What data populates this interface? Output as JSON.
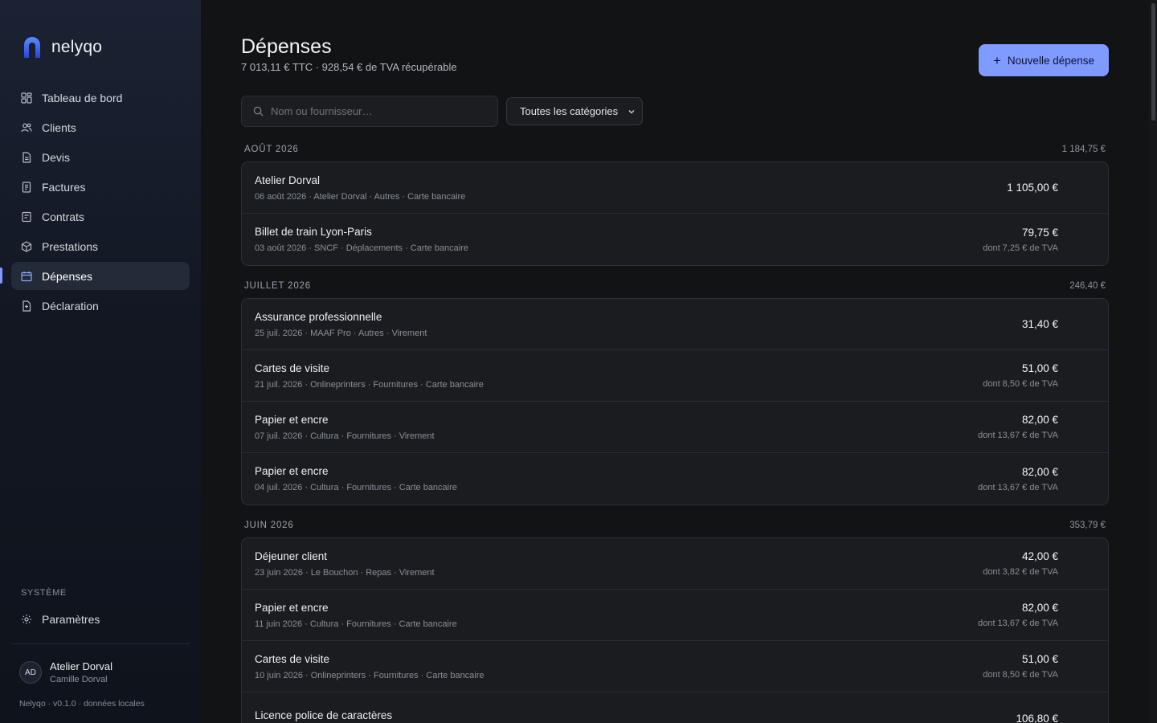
{
  "brand": {
    "name": "nelyqo"
  },
  "nav": [
    {
      "label": "Tableau de bord",
      "icon": "dashboard-icon"
    },
    {
      "label": "Clients",
      "icon": "users-icon"
    },
    {
      "label": "Devis",
      "icon": "document-icon"
    },
    {
      "label": "Factures",
      "icon": "invoice-icon"
    },
    {
      "label": "Contrats",
      "icon": "contract-icon"
    },
    {
      "label": "Prestations",
      "icon": "box-icon"
    },
    {
      "label": "Dépenses",
      "icon": "wallet-icon",
      "active": true
    },
    {
      "label": "Déclaration",
      "icon": "declaration-icon"
    }
  ],
  "system": {
    "label": "SYSTÈME",
    "settings_label": "Paramètres"
  },
  "user": {
    "initials": "AD",
    "name": "Atelier Dorval",
    "sub": "Camille Dorval"
  },
  "version": "Nelyqo · v0.1.0 · données locales",
  "header": {
    "title": "Dépenses",
    "subtitle": "7 013,11 € TTC · 928,54 € de TVA récupérable",
    "new_button": "Nouvelle dépense"
  },
  "filters": {
    "search_placeholder": "Nom ou fournisseur…",
    "category_selected": "Toutes les catégories"
  },
  "colors": {
    "accent": "#7f9bff",
    "background": "#111315",
    "card": "#1a1c20"
  },
  "groups": [
    {
      "month": "AOÛT 2026",
      "total": "1 184,75 €",
      "items": [
        {
          "title": "Atelier Dorval",
          "meta": "06 août 2026 · Atelier Dorval · Autres · Carte bancaire",
          "amount": "1 105,00 €",
          "vat": ""
        },
        {
          "title": "Billet de train Lyon-Paris",
          "meta": "03 août 2026 · SNCF · Déplacements · Carte bancaire",
          "amount": "79,75 €",
          "vat": "dont 7,25 € de TVA"
        }
      ]
    },
    {
      "month": "JUILLET 2026",
      "total": "246,40 €",
      "items": [
        {
          "title": "Assurance professionnelle",
          "meta": "25 juil. 2026 · MAAF Pro · Autres · Virement",
          "amount": "31,40 €",
          "vat": ""
        },
        {
          "title": "Cartes de visite",
          "meta": "21 juil. 2026 · Onlineprinters · Fournitures · Carte bancaire",
          "amount": "51,00 €",
          "vat": "dont 8,50 € de TVA"
        },
        {
          "title": "Papier et encre",
          "meta": "07 juil. 2026 · Cultura · Fournitures · Virement",
          "amount": "82,00 €",
          "vat": "dont 13,67 € de TVA"
        },
        {
          "title": "Papier et encre",
          "meta": "04 juil. 2026 · Cultura · Fournitures · Carte bancaire",
          "amount": "82,00 €",
          "vat": "dont 13,67 € de TVA"
        }
      ]
    },
    {
      "month": "JUIN 2026",
      "total": "353,79 €",
      "items": [
        {
          "title": "Déjeuner client",
          "meta": "23 juin 2026 · Le Bouchon · Repas · Virement",
          "amount": "42,00 €",
          "vat": "dont 3,82 € de TVA"
        },
        {
          "title": "Papier et encre",
          "meta": "11 juin 2026 · Cultura · Fournitures · Carte bancaire",
          "amount": "82,00 €",
          "vat": "dont 13,67 € de TVA"
        },
        {
          "title": "Cartes de visite",
          "meta": "10 juin 2026 · Onlineprinters · Fournitures · Carte bancaire",
          "amount": "51,00 €",
          "vat": "dont 8,50 € de TVA"
        },
        {
          "title": "Licence police de caractères",
          "meta": "",
          "amount": "106,80 €",
          "vat": ""
        }
      ]
    }
  ]
}
